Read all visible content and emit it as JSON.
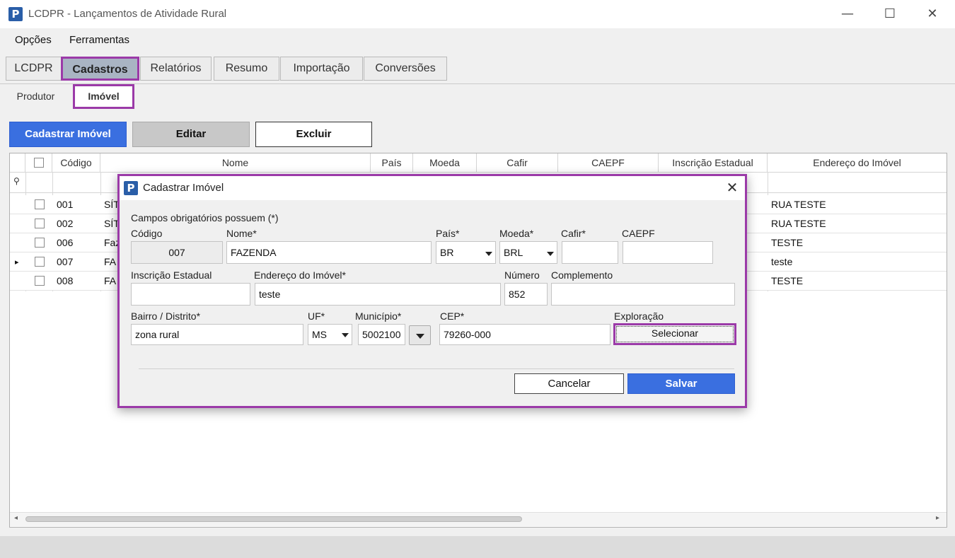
{
  "window": {
    "title": "LCDPR - Lançamentos de Atividade Rural",
    "logo_glyph": "P",
    "minimize": "—",
    "maximize": "☐",
    "close": "✕"
  },
  "menu": {
    "items": [
      "Opções",
      "Ferramentas"
    ]
  },
  "tabs": [
    "LCDPR",
    "Cadastros",
    "Relatórios",
    "Resumo",
    "Importação",
    "Conversões"
  ],
  "active_tab": "Cadastros",
  "subtabs": [
    "Produtor",
    "Imóvel"
  ],
  "active_subtab": "Imóvel",
  "toolbar": {
    "cadastrar_label": "Cadastrar Imóvel",
    "editar_label": "Editar",
    "excluir_label": "Excluir"
  },
  "grid": {
    "columns": [
      "Código",
      "Nome",
      "País",
      "Moeda",
      "Cafir",
      "CAEPF",
      "Inscrição Estadual",
      "Endereço do Imóvel"
    ],
    "filter_icon": "⚲",
    "current_row_marker": "▸",
    "rows": [
      {
        "codigo": "001",
        "nome": "SÍT",
        "endereco": "RUA TESTE"
      },
      {
        "codigo": "002",
        "nome": "SÍT",
        "endereco": "RUA TESTE"
      },
      {
        "codigo": "006",
        "nome": "Faz",
        "endereco": "TESTE"
      },
      {
        "codigo": "007",
        "nome": "FA",
        "endereco": "teste"
      },
      {
        "codigo": "008",
        "nome": "FA",
        "endereco": "TESTE"
      }
    ],
    "scroll_left": "◂",
    "scroll_right": "▸"
  },
  "dialog": {
    "title": "Cadastrar Imóvel",
    "close": "✕",
    "note": "Campos obrigatórios possuem (*)",
    "labels": {
      "codigo": "Código",
      "nome": "Nome*",
      "pais": "País*",
      "moeda": "Moeda*",
      "cafir": "Cafir*",
      "caepf": "CAEPF",
      "inscricao": "Inscrição Estadual",
      "endereco": "Endereço do Imóvel*",
      "numero": "Número",
      "complemento": "Complemento",
      "bairro": "Bairro / Distrito*",
      "uf": "UF*",
      "municipio": "Município*",
      "cep": "CEP*",
      "exploracao": "Exploração"
    },
    "values": {
      "codigo": "007",
      "nome": "FAZENDA",
      "pais": "BR",
      "moeda": "BRL",
      "cafir": "",
      "caepf": "",
      "inscricao": "",
      "endereco": "teste",
      "numero": "852",
      "complemento": "",
      "bairro": "zona rural",
      "uf": "MS",
      "municipio": "5002100",
      "cep": "79260-000"
    },
    "selecionar_label": "Selecionar",
    "cancelar_label": "Cancelar",
    "salvar_label": "Salvar"
  },
  "colors": {
    "accent_blue": "#3a6fe0",
    "highlight_purple": "#9b3aa8",
    "active_tab_bg": "#a9b4c3"
  }
}
